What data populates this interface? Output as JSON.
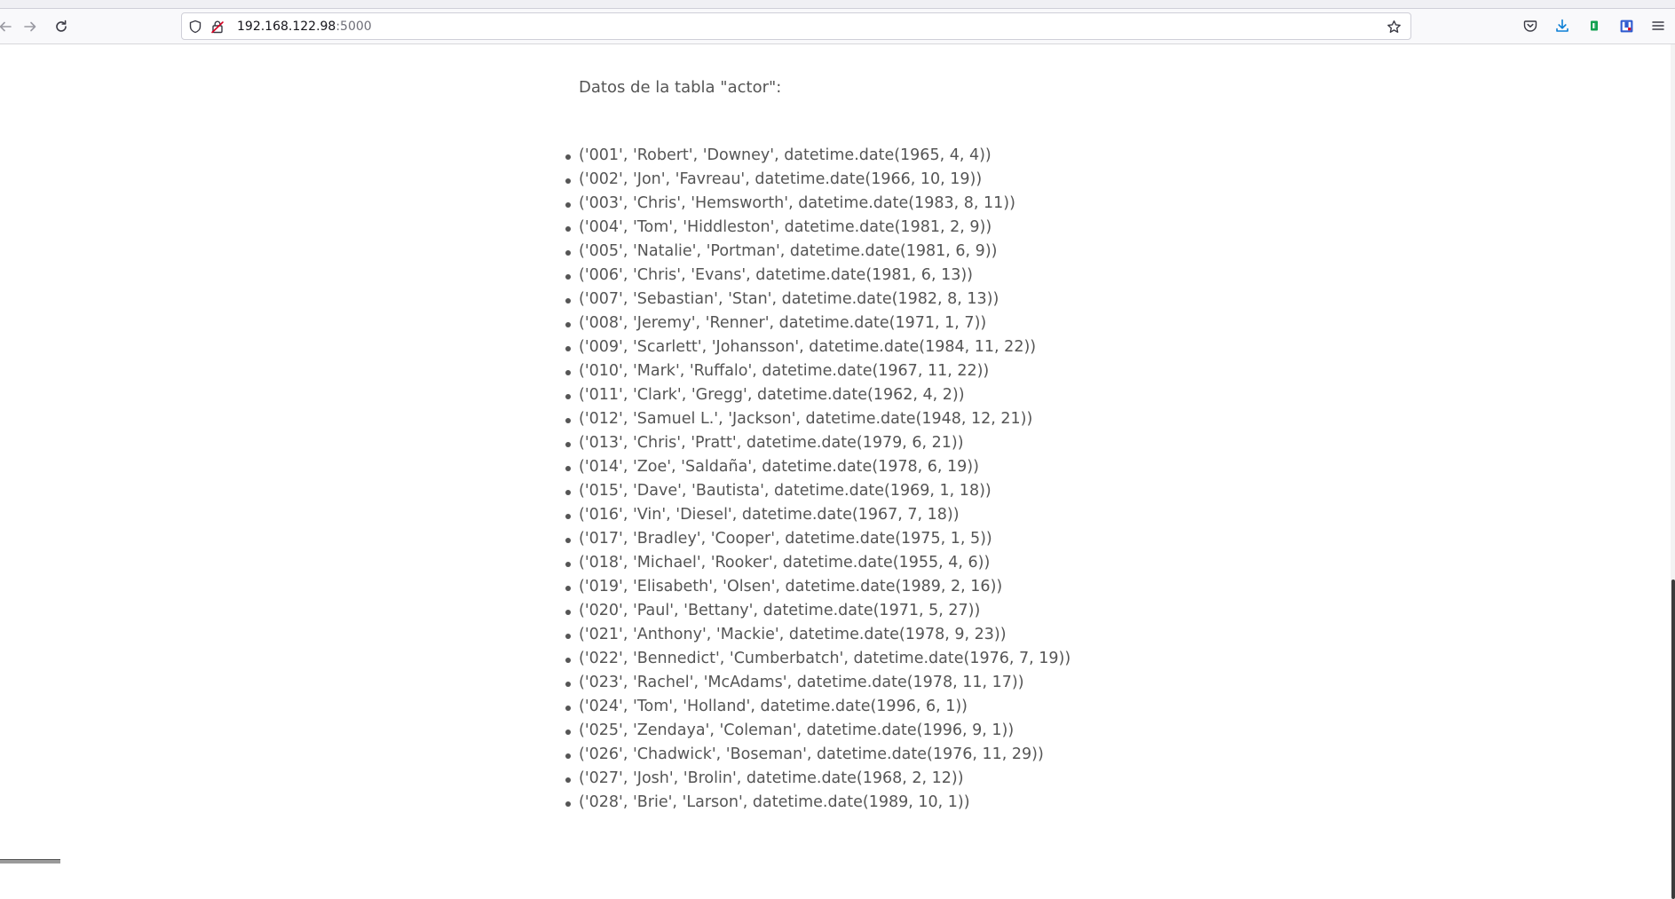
{
  "browser": {
    "url_host": "192.168.122.98",
    "url_port": ":5000",
    "icons": {
      "back": "back-arrow-icon",
      "forward": "forward-arrow-icon",
      "reload": "reload-icon",
      "tracking": "shield-icon",
      "connection": "insecure-lock-icon",
      "bookmark": "star-icon",
      "pocket": "pocket-icon",
      "downloads": "download-icon",
      "extension_green": "extension-icon",
      "extension_blue": "extension-icon",
      "menu": "hamburger-menu-icon"
    },
    "colors": {
      "download_accent": "#0b7fd6",
      "extension_green": "#12a150",
      "extension_blue": "#2e5bd0",
      "insecure_lock": "#d70022"
    }
  },
  "page": {
    "heading": "Datos de la tabla \"actor\":",
    "records": [
      "('001', 'Robert', 'Downey', datetime.date(1965, 4, 4))",
      "('002', 'Jon', 'Favreau', datetime.date(1966, 10, 19))",
      "('003', 'Chris', 'Hemsworth', datetime.date(1983, 8, 11))",
      "('004', 'Tom', 'Hiddleston', datetime.date(1981, 2, 9))",
      "('005', 'Natalie', 'Portman', datetime.date(1981, 6, 9))",
      "('006', 'Chris', 'Evans', datetime.date(1981, 6, 13))",
      "('007', 'Sebastian', 'Stan', datetime.date(1982, 8, 13))",
      "('008', 'Jeremy', 'Renner', datetime.date(1971, 1, 7))",
      "('009', 'Scarlett', 'Johansson', datetime.date(1984, 11, 22))",
      "('010', 'Mark', 'Ruffalo', datetime.date(1967, 11, 22))",
      "('011', 'Clark', 'Gregg', datetime.date(1962, 4, 2))",
      "('012', 'Samuel L.', 'Jackson', datetime.date(1948, 12, 21))",
      "('013', 'Chris', 'Pratt', datetime.date(1979, 6, 21))",
      "('014', 'Zoe', 'Saldaña', datetime.date(1978, 6, 19))",
      "('015', 'Dave', 'Bautista', datetime.date(1969, 1, 18))",
      "('016', 'Vin', 'Diesel', datetime.date(1967, 7, 18))",
      "('017', 'Bradley', 'Cooper', datetime.date(1975, 1, 5))",
      "('018', 'Michael', 'Rooker', datetime.date(1955, 4, 6))",
      "('019', 'Elisabeth', 'Olsen', datetime.date(1989, 2, 16))",
      "('020', 'Paul', 'Bettany', datetime.date(1971, 5, 27))",
      "('021', 'Anthony', 'Mackie', datetime.date(1978, 9, 23))",
      "('022', 'Bennedict', 'Cumberbatch', datetime.date(1976, 7, 19))",
      "('023', 'Rachel', 'McAdams', datetime.date(1978, 11, 17))",
      "('024', 'Tom', 'Holland', datetime.date(1996, 6, 1))",
      "('025', 'Zendaya', 'Coleman', datetime.date(1996, 9, 1))",
      "('026', 'Chadwick', 'Boseman', datetime.date(1976, 11, 29))",
      "('027', 'Josh', 'Brolin', datetime.date(1968, 2, 12))",
      "('028', 'Brie', 'Larson', datetime.date(1989, 10, 1))"
    ]
  }
}
